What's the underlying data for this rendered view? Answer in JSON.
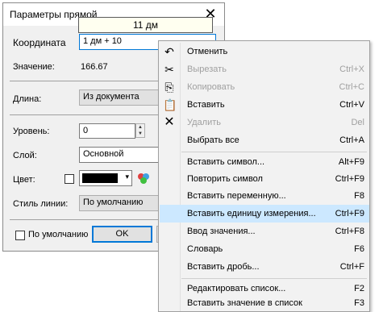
{
  "dialog": {
    "title": "Параметры прямой",
    "tooltip": "11 дм",
    "coord_label": "Координата",
    "coord_value": "1 дм + 10",
    "value_label": "Значение:",
    "value": "166.67",
    "length_label": "Длина:",
    "length_value": "Из документа",
    "level_label": "Уровень:",
    "level_value": "0",
    "layer_label": "Слой:",
    "layer_value": "Основной",
    "color_label": "Цвет:",
    "style_label": "Стиль линии:",
    "style_value": "По умолчанию",
    "default_label": "По умолчанию",
    "ok_label": "OK"
  },
  "colors": {
    "accent": "#0078d7",
    "highlight": "#cce8ff"
  },
  "menu": {
    "items": [
      {
        "label": "Отменить",
        "shortcut": "",
        "icon": "undo-icon"
      },
      {
        "label": "Вырезать",
        "shortcut": "Ctrl+X",
        "icon": "scissors-icon"
      },
      {
        "label": "Копировать",
        "shortcut": "Ctrl+C",
        "icon": "copy-icon"
      },
      {
        "label": "Вставить",
        "shortcut": "Ctrl+V",
        "icon": "paste-icon"
      },
      {
        "label": "Удалить",
        "shortcut": "Del",
        "icon": "delete-icon"
      },
      {
        "label": "Выбрать все",
        "shortcut": "Ctrl+A",
        "icon": ""
      },
      {
        "label": "Вставить символ...",
        "shortcut": "Alt+F9",
        "icon": ""
      },
      {
        "label": "Повторить символ",
        "shortcut": "Ctrl+F9",
        "icon": ""
      },
      {
        "label": "Вставить переменную...",
        "shortcut": "F8",
        "icon": ""
      },
      {
        "label": "Вставить единицу измерения...",
        "shortcut": "Ctrl+F9",
        "icon": ""
      },
      {
        "label": "Ввод значения...",
        "shortcut": "Ctrl+F8",
        "icon": ""
      },
      {
        "label": "Словарь",
        "shortcut": "F6",
        "icon": ""
      },
      {
        "label": "Вставить дробь...",
        "shortcut": "Ctrl+F",
        "icon": ""
      },
      {
        "label": "Редактировать список...",
        "shortcut": "F2",
        "icon": ""
      },
      {
        "label": "Вставить значение в список",
        "shortcut": "F3",
        "icon": ""
      }
    ]
  }
}
